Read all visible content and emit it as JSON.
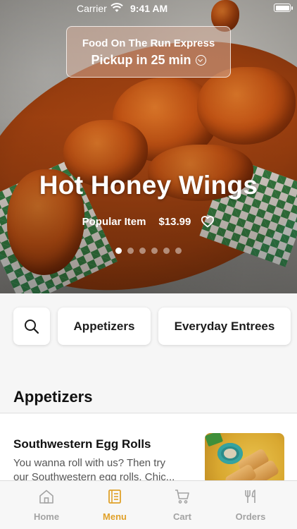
{
  "status_bar": {
    "carrier": "Carrier",
    "time": "9:41 AM"
  },
  "pickup": {
    "store_name": "Food On The Run Express",
    "pickup_time": "Pickup in 25 min"
  },
  "featured": {
    "title": "Hot Honey Wings",
    "tag": "Popular Item",
    "price": "$13.99",
    "carousel": {
      "total": 6,
      "active_index": 0
    }
  },
  "filters": {
    "search_icon": "search-icon",
    "chips": [
      "Appetizers",
      "Everyday Entrees"
    ]
  },
  "section": {
    "title": "Appetizers"
  },
  "menu_items": [
    {
      "name": "Southwestern Egg Rolls",
      "description_line1": "You wanna roll with us? Then try",
      "description_line2": "our Southwestern egg rolls. Chic..."
    }
  ],
  "tabbar": {
    "tabs": [
      {
        "label": "Home",
        "icon": "home-icon",
        "active": false
      },
      {
        "label": "Menu",
        "icon": "menu-book-icon",
        "active": true
      },
      {
        "label": "Cart",
        "icon": "cart-icon",
        "active": false
      },
      {
        "label": "Orders",
        "icon": "fork-knife-icon",
        "active": false
      }
    ]
  },
  "colors": {
    "accent": "#e0a12a",
    "inactive_tab": "#a3a3a3"
  }
}
